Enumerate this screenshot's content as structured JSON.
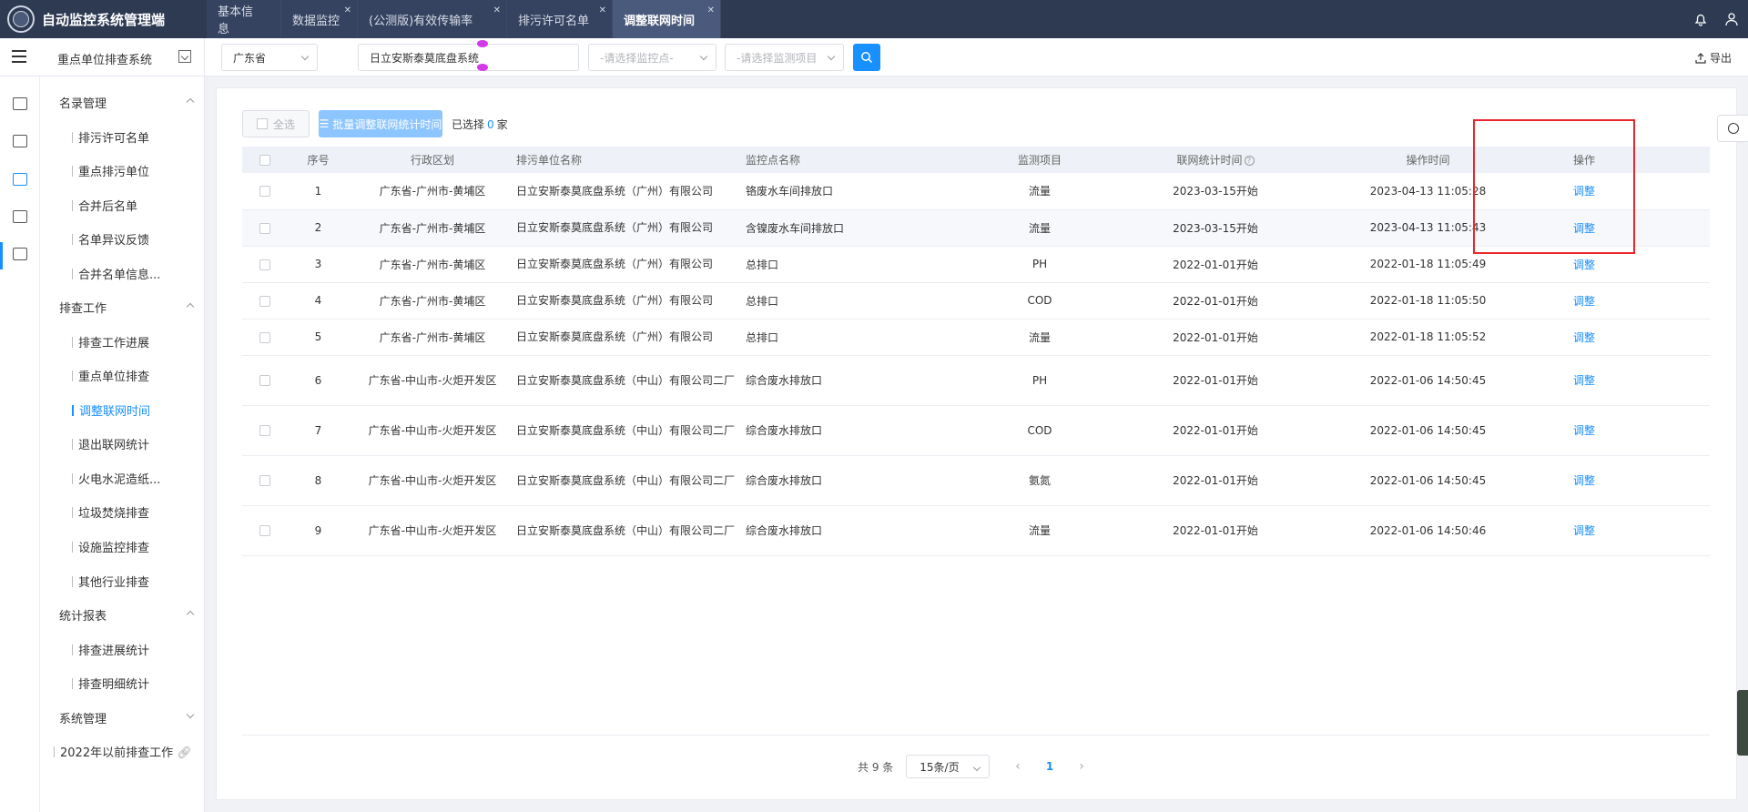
{
  "app": {
    "title": "自动监控系统管理端"
  },
  "tabs": [
    {
      "label": "基本信息",
      "closable": false
    },
    {
      "label": "数据监控",
      "closable": true
    },
    {
      "label": "(公测版)有效传输率",
      "closable": true
    },
    {
      "label": "排污许可名单",
      "closable": true
    },
    {
      "label": "调整联网时间",
      "closable": true,
      "active": true
    }
  ],
  "header": {
    "system_name": "重点单位排查系统",
    "export_label": "导出"
  },
  "filters": {
    "province": "广东省",
    "company": "日立安斯泰莫底盘系统",
    "monitor_point_placeholder": "-请选择监控点-",
    "monitor_item_placeholder": "-请选择监测项目"
  },
  "menu": {
    "groups": [
      {
        "label": "名录管理",
        "items": [
          "排污许可名单",
          "重点排污单位",
          "合并后名单",
          "名单异议反馈",
          "合并名单信息..."
        ]
      },
      {
        "label": "排查工作",
        "items": [
          "排查工作进展",
          "重点单位排查",
          "调整联网时间",
          "退出联网统计",
          "火电水泥造纸...",
          "垃圾焚烧排查",
          "设施监控排查",
          "其他行业排查"
        ]
      },
      {
        "label": "统计报表",
        "items": [
          "排查进展统计",
          "排查明细统计"
        ]
      },
      {
        "label": "系统管理",
        "items": []
      }
    ],
    "external_link": "2022年以前排查工作",
    "active_item": "调整联网时间"
  },
  "toolbar": {
    "select_all": "全选",
    "batch_label": "批量调整联网统计时间",
    "selected_prefix": "已选择",
    "selected_count": "0",
    "selected_suffix": "家"
  },
  "table": {
    "headers": [
      "序号",
      "行政区划",
      "排污单位名称",
      "监控点名称",
      "监测项目",
      "联网统计时间",
      "操作时间",
      "操作"
    ],
    "rows": [
      {
        "no": "1",
        "region": "广东省-广州市-黄埔区",
        "company": "日立安斯泰莫底盘系统（广州）有限公司",
        "point": "铬废水车间排放口",
        "item": "流量",
        "stat_time": "2023-03-15开始",
        "op_time": "2023-04-13 11:05:28",
        "action": "调整"
      },
      {
        "no": "2",
        "region": "广东省-广州市-黄埔区",
        "company": "日立安斯泰莫底盘系统（广州）有限公司",
        "point": "含镍废水车间排放口",
        "item": "流量",
        "stat_time": "2023-03-15开始",
        "op_time": "2023-04-13 11:05:43",
        "action": "调整"
      },
      {
        "no": "3",
        "region": "广东省-广州市-黄埔区",
        "company": "日立安斯泰莫底盘系统（广州）有限公司",
        "point": "总排口",
        "item": "PH",
        "stat_time": "2022-01-01开始",
        "op_time": "2022-01-18 11:05:49",
        "action": "调整"
      },
      {
        "no": "4",
        "region": "广东省-广州市-黄埔区",
        "company": "日立安斯泰莫底盘系统（广州）有限公司",
        "point": "总排口",
        "item": "COD",
        "stat_time": "2022-01-01开始",
        "op_time": "2022-01-18 11:05:50",
        "action": "调整"
      },
      {
        "no": "5",
        "region": "广东省-广州市-黄埔区",
        "company": "日立安斯泰莫底盘系统（广州）有限公司",
        "point": "总排口",
        "item": "流量",
        "stat_time": "2022-01-01开始",
        "op_time": "2022-01-18 11:05:52",
        "action": "调整"
      },
      {
        "no": "6",
        "region": "广东省-中山市-火炬开发区",
        "company": "日立安斯泰莫底盘系统（中山）有限公司二厂",
        "point": "综合废水排放口",
        "item": "PH",
        "stat_time": "2022-01-01开始",
        "op_time": "2022-01-06 14:50:45",
        "action": "调整"
      },
      {
        "no": "7",
        "region": "广东省-中山市-火炬开发区",
        "company": "日立安斯泰莫底盘系统（中山）有限公司二厂",
        "point": "综合废水排放口",
        "item": "COD",
        "stat_time": "2022-01-01开始",
        "op_time": "2022-01-06 14:50:45",
        "action": "调整"
      },
      {
        "no": "8",
        "region": "广东省-中山市-火炬开发区",
        "company": "日立安斯泰莫底盘系统（中山）有限公司二厂",
        "point": "综合废水排放口",
        "item": "氨氮",
        "stat_time": "2022-01-01开始",
        "op_time": "2022-01-06 14:50:45",
        "action": "调整"
      },
      {
        "no": "9",
        "region": "广东省-中山市-火炬开发区",
        "company": "日立安斯泰莫底盘系统（中山）有限公司二厂",
        "point": "综合废水排放口",
        "item": "流量",
        "stat_time": "2022-01-01开始",
        "op_time": "2022-01-06 14:50:46",
        "action": "调整"
      }
    ]
  },
  "pagination": {
    "total_text": "共 9 条",
    "page_size": "15条/页",
    "current_page": "1"
  },
  "colors": {
    "primary": "#1890ff",
    "topbar": "#2d3a52",
    "highlight": "#e8262b"
  },
  "icons": [
    "bell-icon",
    "user-icon",
    "menu-icon",
    "search-icon",
    "export-icon",
    "globe-icon"
  ]
}
